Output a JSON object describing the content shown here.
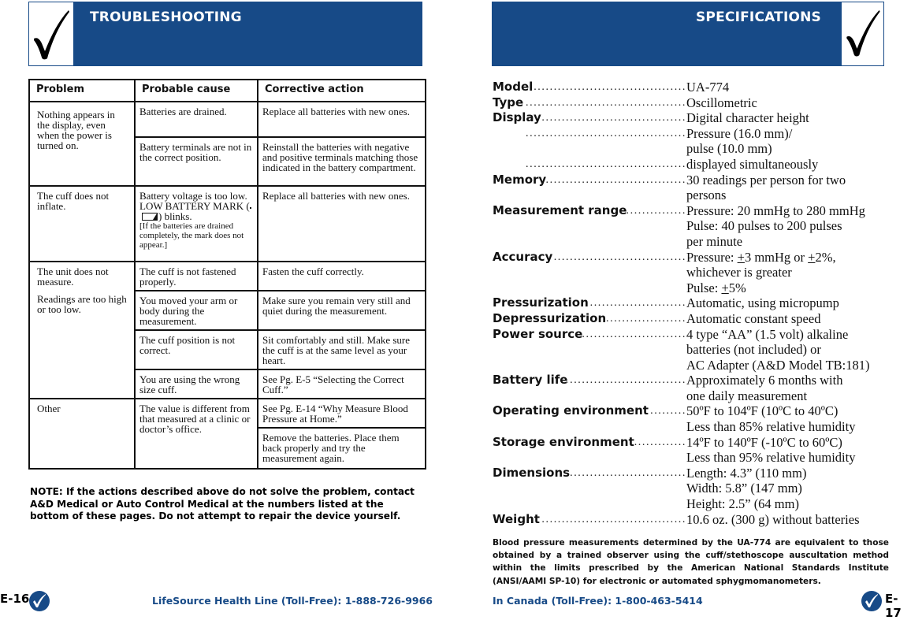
{
  "left_page": {
    "banner_title": "TROUBLESHOOTING",
    "banner_icon": "checkmark-icon",
    "table": {
      "headers": [
        "Problem",
        "Probable cause",
        "Corrective action"
      ],
      "groups": [
        {
          "problem": "Nothing appears in the display, even when the power is turned on.",
          "rows": [
            {
              "cause": "Batteries are drained.",
              "action": "Replace all batteries with new ones."
            },
            {
              "cause": "Battery terminals are not in the correct position.",
              "action": "Reinstall the batteries with negative and positive terminals matching those indicated in the battery compartment."
            }
          ]
        },
        {
          "problem": "The cuff does not inflate.",
          "rows": [
            {
              "cause_part1": "Battery voltage is too low. LOW BATTERY MARK (",
              "cause_part2": ") blinks.",
              "cause_note": "[If the batteries are drained completely, the mark does not appear.]",
              "action": "Replace all batteries with new ones."
            }
          ]
        },
        {
          "problem": "The unit does not measure.",
          "problem2": "Readings are too high or too low.",
          "rows": [
            {
              "cause": "The cuff is not fastened properly.",
              "action": "Fasten the cuff correctly."
            },
            {
              "cause": "You moved your arm or body during the measurement.",
              "action": "Make sure you remain very still and quiet during the measurement."
            },
            {
              "cause": "The cuff position is not correct.",
              "action": "Sit comfortably and still. Make sure the cuff is at the same level as your heart."
            },
            {
              "cause": "You are using the wrong size cuff.",
              "action": "See Pg. E-5 “Selecting the Correct Cuff.”"
            }
          ]
        },
        {
          "problem": "Other",
          "rows": [
            {
              "cause": "The value is different from that measured at a clinic or doctor’s office.",
              "action": "See Pg. E-14 “Why Measure Blood Pressure at Home.”"
            },
            {
              "action": "Remove the batteries. Place them back properly and try the measurement again."
            }
          ]
        }
      ]
    },
    "note": "NOTE: If the actions described above do not solve the problem, contact A&D Medical or Auto Control Medical at the numbers listed at the bottom of these pages. Do not attempt to repair the device yourself.",
    "page_number": "E-16",
    "footer": "LifeSource Health Line (Toll-Free): 1-888-726-9966"
  },
  "right_page": {
    "banner_title": "SPECIFICATIONS",
    "banner_icon": "checkmark-icon",
    "specs": [
      {
        "label": "Model",
        "values": [
          "UA-774"
        ]
      },
      {
        "label": "Type",
        "values": [
          "Oscillometric"
        ]
      },
      {
        "label": "Display",
        "values": [
          "Digital character height"
        ]
      },
      {
        "label": "",
        "values": [
          "Pressure (16.0 mm)/",
          "pulse (10.0 mm)"
        ]
      },
      {
        "label": "",
        "values": [
          "displayed simultaneously"
        ]
      },
      {
        "label": "Memory",
        "values": [
          "30 readings per person for two",
          "persons"
        ]
      },
      {
        "label": "Measurement range",
        "values": [
          "Pressure: 20 mmHg to 280 mmHg",
          "Pulse: 40 pulses to 200 pulses",
          "per minute"
        ]
      },
      {
        "label": "Accuracy",
        "values": [
          "Pressure: +3 mmHg or +2%,",
          "whichever is greater",
          "Pulse: +5%"
        ]
      },
      {
        "label": "Pressurization",
        "values": [
          "Automatic, using micropump"
        ]
      },
      {
        "label": "Depressurization",
        "values": [
          "Automatic constant speed"
        ]
      },
      {
        "label": "Power source",
        "values": [
          "4 type “AA” (1.5 volt) alkaline",
          "batteries (not included) or",
          "AC Adapter (A&D Model TB:181)"
        ]
      },
      {
        "label": "Battery life",
        "values": [
          "Approximately 6 months with",
          "one daily measurement"
        ]
      },
      {
        "label": "Operating environment",
        "values": [
          "50ºF to 104ºF (10ºC to 40ºC)",
          "Less than 85% relative humidity"
        ]
      },
      {
        "label": "Storage environment",
        "values": [
          "14ºF to 140ºF (-10ºC to 60ºC)",
          "Less than 95% relative humidity"
        ]
      },
      {
        "label": "Dimensions",
        "values": [
          "Length: 4.3” (110 mm)",
          "Width: 5.8” (147 mm)",
          "Height: 2.5” (64 mm)"
        ]
      },
      {
        "label": "Weight",
        "values": [
          "10.6 oz. (300 g) without batteries"
        ]
      }
    ],
    "bp_note": "Blood pressure measurements determined by the UA-774 are equivalent to those obtained by a trained observer using the cuff/stethoscope auscultation method within the limits prescribed by the American National Standards Institute (ANSI/AAMI SP-10) for electronic or automated sphygmomanometers.",
    "footer": "In Canada (Toll-Free): 1-800-463-5414",
    "page_number": "E-17"
  },
  "colors": {
    "brand_blue": "#174a87",
    "text": "#111111",
    "background": "#ffffff"
  }
}
